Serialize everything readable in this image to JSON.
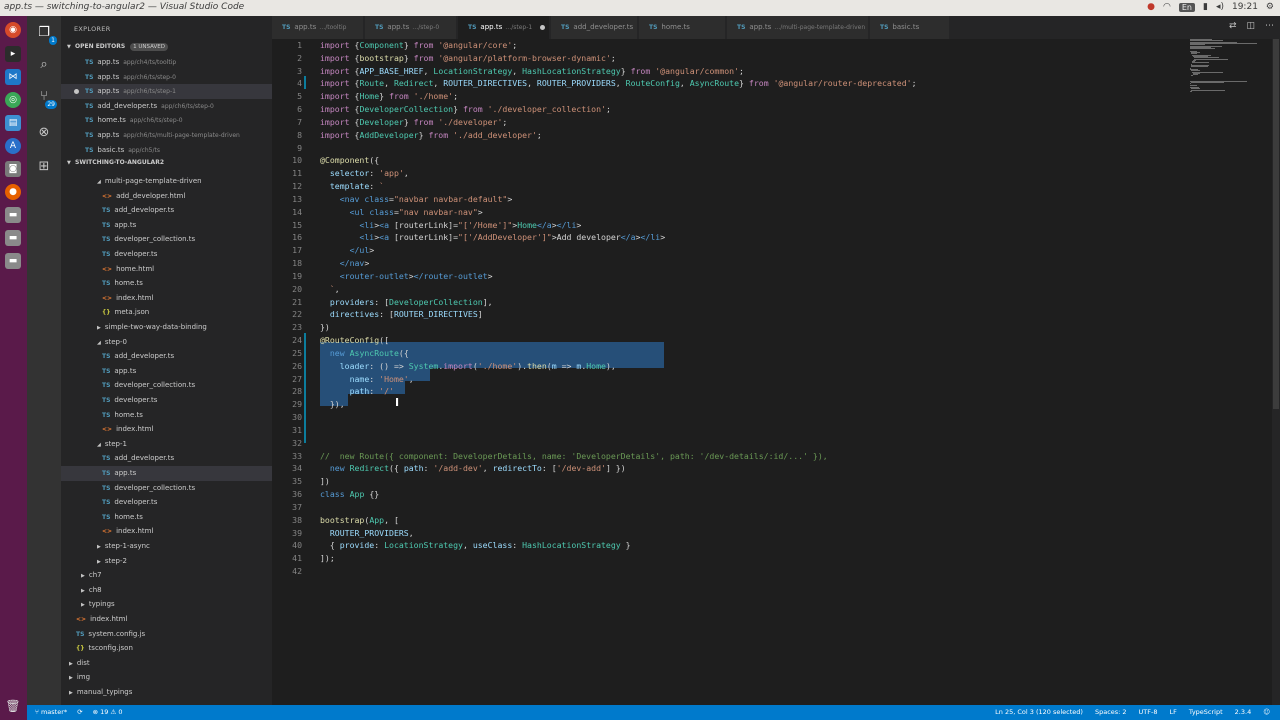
{
  "window": {
    "title": "app.ts — switching-to-angular2 — Visual Studio Code"
  },
  "tray": {
    "keyboard": "En",
    "time": "19:21"
  },
  "activity": {
    "explorer_badge": "1",
    "git_badge": "29"
  },
  "sidebar": {
    "title": "EXPLORER",
    "open_editors_label": "OPEN EDITORS",
    "unsaved_label": "1 UNSAVED",
    "open_editors": [
      {
        "name": "app.ts",
        "desc": "app/ch4/ts/tooltip"
      },
      {
        "name": "app.ts",
        "desc": "app/ch6/ts/step-0"
      },
      {
        "name": "app.ts",
        "desc": "app/ch6/ts/step-1"
      },
      {
        "name": "add_developer.ts",
        "desc": "app/ch6/ts/step-0"
      },
      {
        "name": "home.ts",
        "desc": "app/ch6/ts/step-0"
      },
      {
        "name": "app.ts",
        "desc": "app/ch6/ts/multi-page-template-driven"
      },
      {
        "name": "basic.ts",
        "desc": "app/ch5/ts"
      }
    ],
    "project_label": "SWITCHING-TO-ANGULAR2",
    "tree": [
      {
        "name": "multi-page-template-driven",
        "kind": "folder"
      },
      {
        "name": "add_developer.html",
        "kind": "html"
      },
      {
        "name": "add_developer.ts",
        "kind": "ts"
      },
      {
        "name": "app.ts",
        "kind": "ts"
      },
      {
        "name": "developer_collection.ts",
        "kind": "ts"
      },
      {
        "name": "developer.ts",
        "kind": "ts"
      },
      {
        "name": "home.html",
        "kind": "html"
      },
      {
        "name": "home.ts",
        "kind": "ts"
      },
      {
        "name": "index.html",
        "kind": "html"
      },
      {
        "name": "meta.json",
        "kind": "json"
      },
      {
        "name": "simple-two-way-data-binding",
        "kind": "folder"
      },
      {
        "name": "step-0",
        "kind": "folder"
      },
      {
        "name": "add_developer.ts",
        "kind": "ts"
      },
      {
        "name": "app.ts",
        "kind": "ts"
      },
      {
        "name": "developer_collection.ts",
        "kind": "ts"
      },
      {
        "name": "developer.ts",
        "kind": "ts"
      },
      {
        "name": "home.ts",
        "kind": "ts"
      },
      {
        "name": "index.html",
        "kind": "html"
      },
      {
        "name": "step-1",
        "kind": "folder"
      },
      {
        "name": "add_developer.ts",
        "kind": "ts"
      },
      {
        "name": "app.ts",
        "kind": "ts"
      },
      {
        "name": "developer_collection.ts",
        "kind": "ts"
      },
      {
        "name": "developer.ts",
        "kind": "ts"
      },
      {
        "name": "home.ts",
        "kind": "ts"
      },
      {
        "name": "index.html",
        "kind": "html"
      },
      {
        "name": "step-1-async",
        "kind": "folder"
      },
      {
        "name": "step-2",
        "kind": "folder"
      },
      {
        "name": "ch7",
        "kind": "folder"
      },
      {
        "name": "ch8",
        "kind": "folder"
      },
      {
        "name": "typings",
        "kind": "folder"
      },
      {
        "name": "index.html",
        "kind": "html"
      },
      {
        "name": "system.config.js",
        "kind": "ts"
      },
      {
        "name": "tsconfig.json",
        "kind": "json"
      },
      {
        "name": "dist",
        "kind": "folder"
      },
      {
        "name": "img",
        "kind": "folder"
      },
      {
        "name": "manual_typings",
        "kind": "folder"
      }
    ]
  },
  "tabs": [
    {
      "name": "app.ts",
      "desc": "…/tooltip"
    },
    {
      "name": "app.ts",
      "desc": "…/step-0"
    },
    {
      "name": "app.ts",
      "desc": "…/step-1"
    },
    {
      "name": "add_developer.ts",
      "desc": ""
    },
    {
      "name": "home.ts",
      "desc": ""
    },
    {
      "name": "app.ts",
      "desc": "…/multi-page-template-driven"
    },
    {
      "name": "basic.ts",
      "desc": ""
    }
  ],
  "icons": {
    "ts": "TS",
    "html": "<>",
    "json": "{}"
  },
  "editor": {
    "lines": [
      "import {Component} from '@angular/core';",
      "import {bootstrap} from '@angular/platform-browser-dynamic';",
      "import {APP_BASE_HREF, LocationStrategy, HashLocationStrategy} from '@angular/common';",
      "import {Route, Redirect, ROUTER_DIRECTIVES, ROUTER_PROVIDERS, RouteConfig, AsyncRoute} from '@angular/router-deprecated';",
      "import {Home} from './home';",
      "import {DeveloperCollection} from './developer_collection';",
      "import {Developer} from './developer';",
      "import {AddDeveloper} from './add_developer';",
      "",
      "@Component({",
      "  selector: 'app',",
      "  template: `",
      "    <nav class=\"navbar navbar-default\">",
      "      <ul class=\"nav navbar-nav\">",
      "        <li><a [routerLink]=\"['/Home']\">Home</a></li>",
      "        <li><a [routerLink]=\"['/AddDeveloper']\">Add developer</a></li>",
      "      </ul>",
      "    </nav>",
      "    <router-outlet></router-outlet>",
      "  `,",
      "  providers: [DeveloperCollection],",
      "  directives: [ROUTER_DIRECTIVES]",
      "})",
      "@RouteConfig([",
      "  new AsyncRoute({",
      "    loader: () => System.import('./home').then(m => m.Home),",
      "      name: 'Home',",
      "      path: '/'",
      "  }),",
      "",
      "",
      "",
      "//  new Route({ component: DeveloperDetails, name: 'DeveloperDetails', path: '/dev-details/:id/...' }),",
      "  new Redirect({ path: '/add-dev', redirectTo: ['/dev-add'] })",
      "])",
      "class App {}",
      "",
      "bootstrap(App, [",
      "  ROUTER_PROVIDERS,",
      "  { provide: LocationStrategy, useClass: HashLocationStrategy }",
      "]);",
      ""
    ]
  },
  "status": {
    "branch": "master*",
    "errors": "19",
    "warnings": "0",
    "position": "Ln 25, Col 3 (120 selected)",
    "spaces": "Spaces: 2",
    "encoding": "UTF-8",
    "eol": "LF",
    "language": "TypeScript",
    "version": "2.3.4"
  }
}
